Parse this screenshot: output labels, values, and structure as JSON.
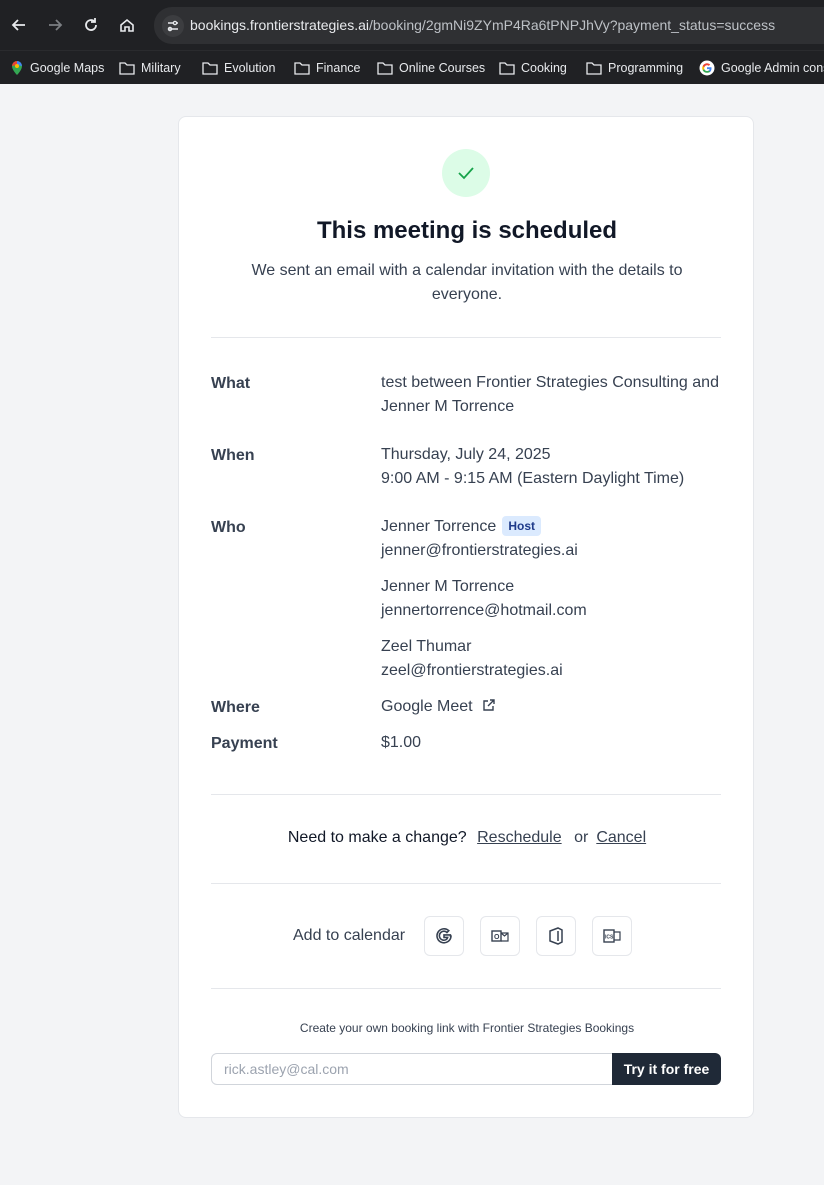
{
  "browser": {
    "url_host": "bookings.frontierstrategies.ai",
    "url_path": "/booking/2gmNi9ZYmP4Ra6tPNPJhVy?payment_status=success",
    "bookmarks": [
      {
        "label": "Google Maps",
        "icon": "maps-pin-icon"
      },
      {
        "label": "Military",
        "icon": "folder-icon"
      },
      {
        "label": "Evolution",
        "icon": "folder-icon"
      },
      {
        "label": "Finance",
        "icon": "folder-icon"
      },
      {
        "label": "Online Courses",
        "icon": "folder-icon"
      },
      {
        "label": "Cooking",
        "icon": "folder-icon"
      },
      {
        "label": "Programming",
        "icon": "folder-icon"
      },
      {
        "label": "Google Admin cons",
        "icon": "google-icon"
      }
    ]
  },
  "booking": {
    "title": "This meeting is scheduled",
    "subtitle": "We sent an email with a calendar invitation with the details to everyone.",
    "what_label": "What",
    "what_value": "test between Frontier Strategies Consulting and Jenner M Torrence",
    "when_label": "When",
    "when_date": "Thursday, July 24, 2025",
    "when_time": "9:00 AM - 9:15 AM (Eastern Daylight Time)",
    "who_label": "Who",
    "attendees": [
      {
        "name": "Jenner Torrence",
        "email": "jenner@frontierstrategies.ai",
        "badge": "Host"
      },
      {
        "name": "Jenner M Torrence",
        "email": "jennertorrence@hotmail.com"
      },
      {
        "name": "Zeel Thumar",
        "email": "zeel@frontierstrategies.ai"
      }
    ],
    "where_label": "Where",
    "where_value": "Google Meet",
    "payment_label": "Payment",
    "payment_value": "$1.00"
  },
  "change": {
    "prompt": "Need to make a change?",
    "reschedule": "Reschedule",
    "or": "or",
    "cancel": "Cancel"
  },
  "calendar": {
    "label": "Add to calendar",
    "buttons": [
      "google-calendar-icon",
      "outlook-icon",
      "office365-icon",
      "ics-file-icon"
    ]
  },
  "promo": {
    "text": "Create your own booking link with Frontier Strategies Bookings",
    "placeholder": "rick.astley@cal.com",
    "button": "Try it for free"
  },
  "colors": {
    "chrome_bg": "#202124",
    "page_bg": "#f3f4f6",
    "success_bg": "#dcfce7",
    "success_fg": "#16a34a",
    "badge_bg": "#dbeafe",
    "button_bg": "#1f2937"
  }
}
